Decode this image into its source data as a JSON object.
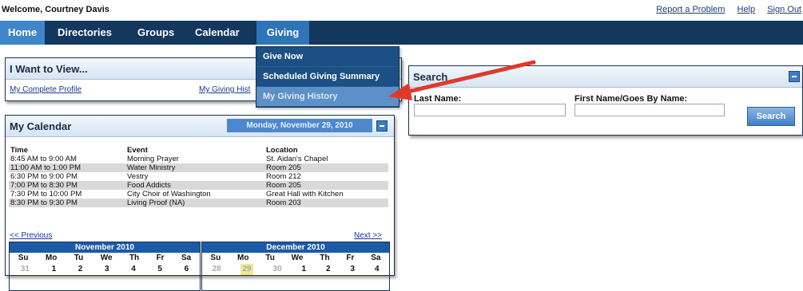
{
  "header": {
    "welcome": "Welcome, Courtney Davis",
    "links": [
      "Report a Problem",
      "Help",
      "Sign Out"
    ]
  },
  "nav": {
    "items": [
      "Home",
      "Directories",
      "Groups",
      "Calendar",
      "Giving"
    ],
    "active": "Giving"
  },
  "giving_menu": {
    "items": [
      "Give Now",
      "Scheduled Giving Summary",
      "My Giving History"
    ],
    "highlighted": "My Giving History"
  },
  "i_want": {
    "title": "I Want to View...",
    "links": [
      "My Complete Profile",
      "My Giving Hist"
    ]
  },
  "search": {
    "title": "Search",
    "last_name_label": "Last Name:",
    "first_name_label": "First Name/Goes By Name:",
    "button": "Search"
  },
  "calendar": {
    "title": "My Calendar",
    "current_date": "Monday, November 29, 2010",
    "columns": [
      "Time",
      "Event",
      "Location"
    ],
    "rows": [
      [
        "8:45 AM to 9:00 AM",
        "Morning Prayer",
        "St. Aidan's Chapel"
      ],
      [
        "11:00 AM to 1:00 PM",
        "Water Ministry",
        "Room 205"
      ],
      [
        "6:30 PM to 9:00 PM",
        "Vestry",
        "Room 212"
      ],
      [
        "7:00 PM to 8:30 PM",
        "Food Addicts",
        "Room 205"
      ],
      [
        "7:30 PM to 10:00 PM",
        "City Choir of Washington",
        "Great Hall with Kitchen"
      ],
      [
        "8:30 PM to 9:30 PM",
        "Living Proof (NA)",
        "Room 203"
      ]
    ],
    "prev": "<< Previous",
    "next": "Next >>",
    "weekdays": [
      "Su",
      "Mo",
      "Tu",
      "We",
      "Th",
      "Fr",
      "Sa"
    ],
    "months": [
      {
        "name": "November 2010",
        "first_row": [
          "31",
          "1",
          "2",
          "3",
          "4",
          "5",
          "6"
        ]
      },
      {
        "name": "December 2010",
        "first_row": [
          "28",
          "29",
          "30",
          "1",
          "2",
          "3",
          "4"
        ]
      }
    ]
  },
  "colors": {
    "navbar": "#13375d",
    "nav_home": "#3f86c8",
    "nav_giving": "#2f74b8",
    "arrow": "#e0392b"
  }
}
